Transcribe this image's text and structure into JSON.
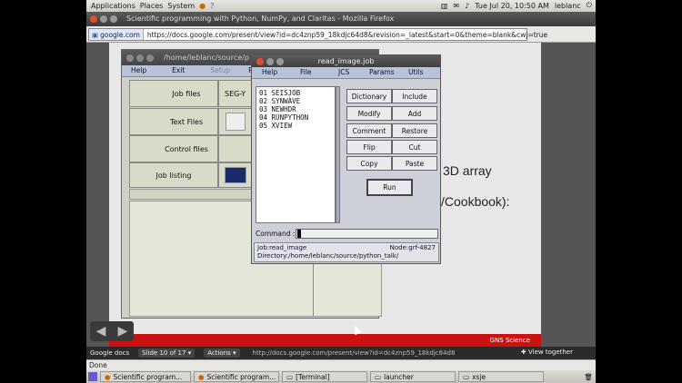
{
  "top_panel": {
    "menus": [
      "Applications",
      "Places",
      "System"
    ],
    "clock": "Tue Jul 20, 10:50 AM",
    "user": "leblanc"
  },
  "firefox": {
    "title": "Scientific programming with Python, NumPy, and Claritas - Mozilla Firefox",
    "site_label": "google.com",
    "url": "https://docs.google.com/present/view?id=dc4znp59_18kdjc64d8&revision=_latest&start=0&theme=blank&cwj=true"
  },
  "slide": {
    "text1": "3D array",
    "text2": "/Cookbook):",
    "footer_brand": "GNS Science"
  },
  "claritas": {
    "title": "/home/leblanc/source/p",
    "menu": [
      "Help",
      "Exit",
      "Setup",
      "P"
    ],
    "buttons": {
      "job_files": "Job files",
      "text_files": "Text Files",
      "control_files": "Control files",
      "job_listing": "Job listing",
      "seg": "SEG-Y"
    }
  },
  "read_image": {
    "title": "read_image.job",
    "menu": [
      "Help",
      "File",
      "JCS",
      "Params",
      "Utils"
    ],
    "list_items": [
      "01 SEISJOB",
      "02 SYNWAVE",
      "03 NEWHDR",
      "04 RUNPYTHON",
      "05 XVIEW"
    ],
    "buttons": {
      "dictionary": "Dictionary",
      "include": "Include",
      "modify": "Modify",
      "add": "Add",
      "comment": "Comment",
      "restore": "Restore",
      "flip": "Flip",
      "cut": "Cut",
      "copy": "Copy",
      "paste": "Paste",
      "run": "Run"
    },
    "command_label": "Command :",
    "job": "Job:read_image",
    "node": "Node:grf-4827",
    "directory": "Directory:/home/leblanc/source/python_talk/"
  },
  "gdocs": {
    "logo": "Google docs",
    "slide_counter": "Slide 10 of 17",
    "actions": "Actions",
    "url": "http://docs.google.com/present/view?id=dc4znp59_18kdjc64d8",
    "view_together": "View together"
  },
  "status": "Done",
  "taskbar": [
    "Scientific program...",
    "Scientific program...",
    "[Terminal]",
    "launcher",
    "xsje"
  ]
}
